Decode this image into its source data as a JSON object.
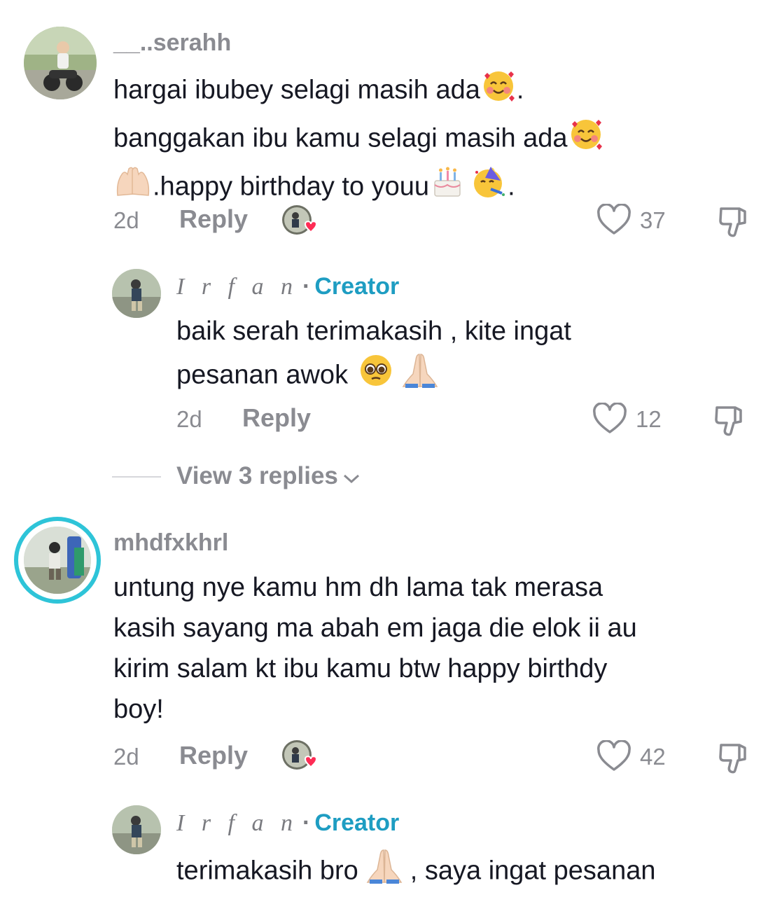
{
  "comments": [
    {
      "username": "__..serahh",
      "text_lines": [
        "hargai ibubey selagi masih ada",
        ".",
        "banggakan ibu kamu selagi masih ada",
        ".happy birthday to youu",
        "."
      ],
      "emojis": [
        "smiling-face-with-hearts",
        "smiling-face-with-hearts",
        "raising-hands",
        "birthday-cake",
        "partying-face"
      ],
      "time": "2d",
      "reply_label": "Reply",
      "likes": "37",
      "reply": {
        "author": "I r f a n",
        "badge": "Creator",
        "separator": "·",
        "text_line1": "baik serah terimakasih , kite ingat",
        "text_line2": "pesanan awok",
        "emojis": [
          "pleading-face",
          "folded-hands"
        ],
        "time": "2d",
        "reply_label": "Reply",
        "likes": "12"
      },
      "view_more": "View 3 replies"
    },
    {
      "username": "mhdfxkhrl",
      "text_lines": [
        "untung nye kamu hm dh lama tak merasa",
        "kasih sayang ma abah em jaga die elok ii au",
        "kirim salam kt ibu kamu btw happy birthdy",
        "boy!"
      ],
      "time": "2d",
      "reply_label": "Reply",
      "likes": "42",
      "reply": {
        "author": "I r f a n",
        "badge": "Creator",
        "separator": "·",
        "text_before": "terimakasih bro",
        "text_after": ", saya ingat pesanan",
        "emojis": [
          "folded-hands"
        ]
      }
    }
  ],
  "icons": {
    "like": "heart-outline-icon",
    "dislike": "thumbs-down-icon",
    "creator_liked": "creator-heart-avatar-icon"
  },
  "colors": {
    "creator_badge": "#1e9dc2",
    "story_ring": "#2ec4d8",
    "muted": "#8a8b91",
    "heart_red": "#fe2c55"
  }
}
